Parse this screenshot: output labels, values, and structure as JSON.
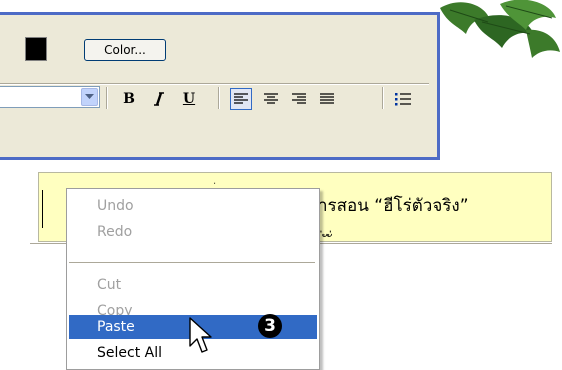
{
  "toolbar": {
    "color_button_label": "Color...",
    "format_buttons": [
      {
        "name": "bold",
        "glyph": "B"
      },
      {
        "name": "italic",
        "glyph": "I"
      },
      {
        "name": "underline",
        "glyph": "U"
      }
    ],
    "selected_alignment": "align-left"
  },
  "editor": {
    "text_line_1": "ารสอน “ฮีโร่ตัวจริง”",
    "text_line_2": "ุ ่  ั  ั่ ",
    "fragment": "่"
  },
  "context_menu": {
    "items": [
      {
        "label": "Undo",
        "enabled": false
      },
      {
        "label": "Redo",
        "enabled": false
      },
      {
        "label": "Cut",
        "enabled": false
      },
      {
        "label": "Copy",
        "enabled": false
      },
      {
        "label": "Paste",
        "enabled": true,
        "highlighted": true
      },
      {
        "label": "Select All",
        "enabled": true
      }
    ]
  },
  "step_marker": "3",
  "colors": {
    "panel_bg": "#ece9d8",
    "panel_border": "#4d6bc6",
    "editor_bg": "#ffffc0",
    "highlight": "#316ac5"
  }
}
